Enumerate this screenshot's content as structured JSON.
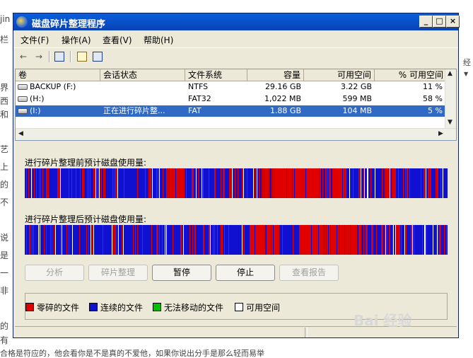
{
  "background": {
    "left_fragments": [
      "jin",
      "栏",
      "",
      "",
      "",
      "界",
      "西",
      "和",
      "",
      "",
      "艺",
      "上",
      "的",
      "不",
      "",
      "",
      "说",
      "是",
      "一",
      "非",
      "",
      "的",
      "有"
    ],
    "bottom_text": "合格是符应的，他会看你是不是真的不爱他，如果你说出分手是那么轻而易举",
    "right_fragments": [
      "经",
      "▼"
    ]
  },
  "window": {
    "title": "磁盘碎片整理程序",
    "controls": {
      "minimize": "_",
      "maximize": "□",
      "close": "×"
    }
  },
  "menu": [
    {
      "label": "文件(F)"
    },
    {
      "label": "操作(A)"
    },
    {
      "label": "查看(V)"
    },
    {
      "label": "帮助(H)"
    }
  ],
  "toolbar": {
    "back": "←",
    "forward": "→"
  },
  "volumes": {
    "columns": [
      "卷",
      "会话状态",
      "文件系统",
      "容量",
      "可用空间",
      "% 可用空间"
    ],
    "rows": [
      {
        "volume": "BACKUP (F:)",
        "status": "",
        "fs": "NTFS",
        "capacity": "29.16 GB",
        "free": "3.22 GB",
        "pct": "11 %",
        "selected": false
      },
      {
        "volume": "(H:)",
        "status": "",
        "fs": "FAT32",
        "capacity": "1,022 MB",
        "free": "599 MB",
        "pct": "58 %",
        "selected": false
      },
      {
        "volume": "(I:)",
        "status": "正在进行碎片整...",
        "fs": "FAT",
        "capacity": "1.88 GB",
        "free": "104 MB",
        "pct": "5 %",
        "selected": true
      }
    ]
  },
  "before_label": "进行碎片整理前预计磁盘使用量:",
  "after_label": "进行碎片整理后预计磁盘使用量:",
  "colors": {
    "fragmented": "#e00000",
    "contiguous": "#1010d0",
    "unmovable": "#00c000",
    "free": "#ffffff"
  },
  "buttons": [
    {
      "label": "分析",
      "enabled": false
    },
    {
      "label": "碎片整理",
      "enabled": false
    },
    {
      "label": "暂停",
      "enabled": true
    },
    {
      "label": "停止",
      "enabled": true
    },
    {
      "label": "查看报告",
      "enabled": false
    }
  ],
  "legend": [
    {
      "label": "零碎的文件",
      "color": "#e00000"
    },
    {
      "label": "连续的文件",
      "color": "#1010d0"
    },
    {
      "label": "无法移动的文件",
      "color": "#00c000"
    },
    {
      "label": "可用空间",
      "color": "#ffffff"
    }
  ],
  "watermark": "Bai 经验"
}
